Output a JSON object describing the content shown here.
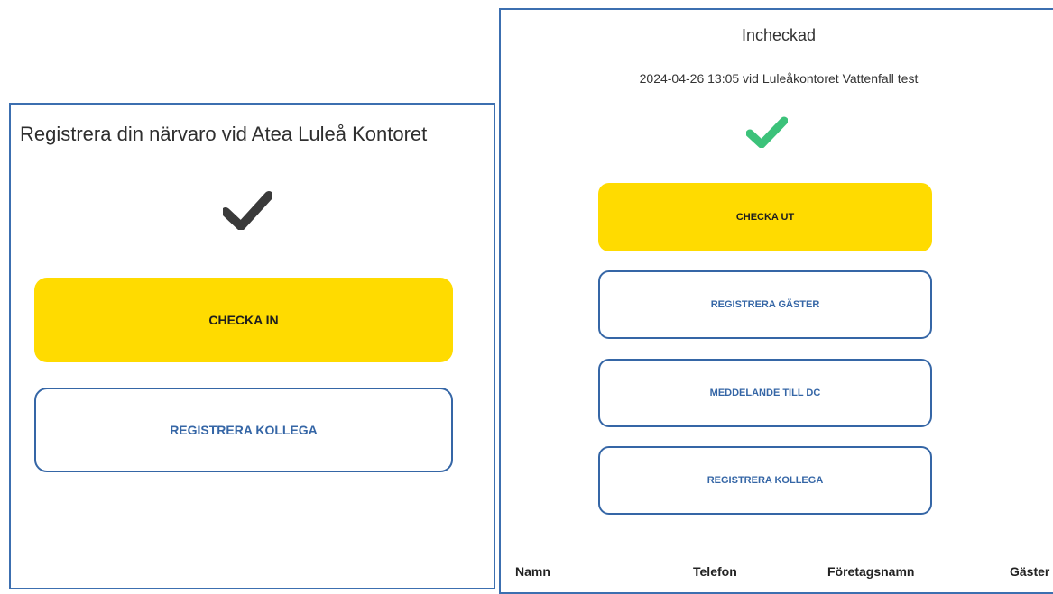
{
  "left_panel": {
    "title": "Registrera din närvaro vid Atea Luleå Kontoret",
    "check_icon_color": "#3a3a3a",
    "checkin_label": "CHECKA IN",
    "register_colleague_label": "REGISTRERA KOLLEGA"
  },
  "right_panel": {
    "title": "Incheckad",
    "subtitle": "2024-04-26 13:05 vid Luleåkontoret Vattenfall test",
    "check_icon_color": "#3cc27a",
    "checkout_label": "CHECKA UT",
    "register_guests_label": "REGISTRERA GÄSTER",
    "message_dc_label": "MEDDELANDE TILL DC",
    "register_colleague_label": "REGISTRERA KOLLEGA",
    "table_headers": [
      "Namn",
      "Telefon",
      "Företagsnamn",
      "Gäster"
    ]
  },
  "colors": {
    "accent_yellow": "#ffdb00",
    "accent_blue": "#3566a6",
    "panel_border": "#3c6fb0"
  }
}
